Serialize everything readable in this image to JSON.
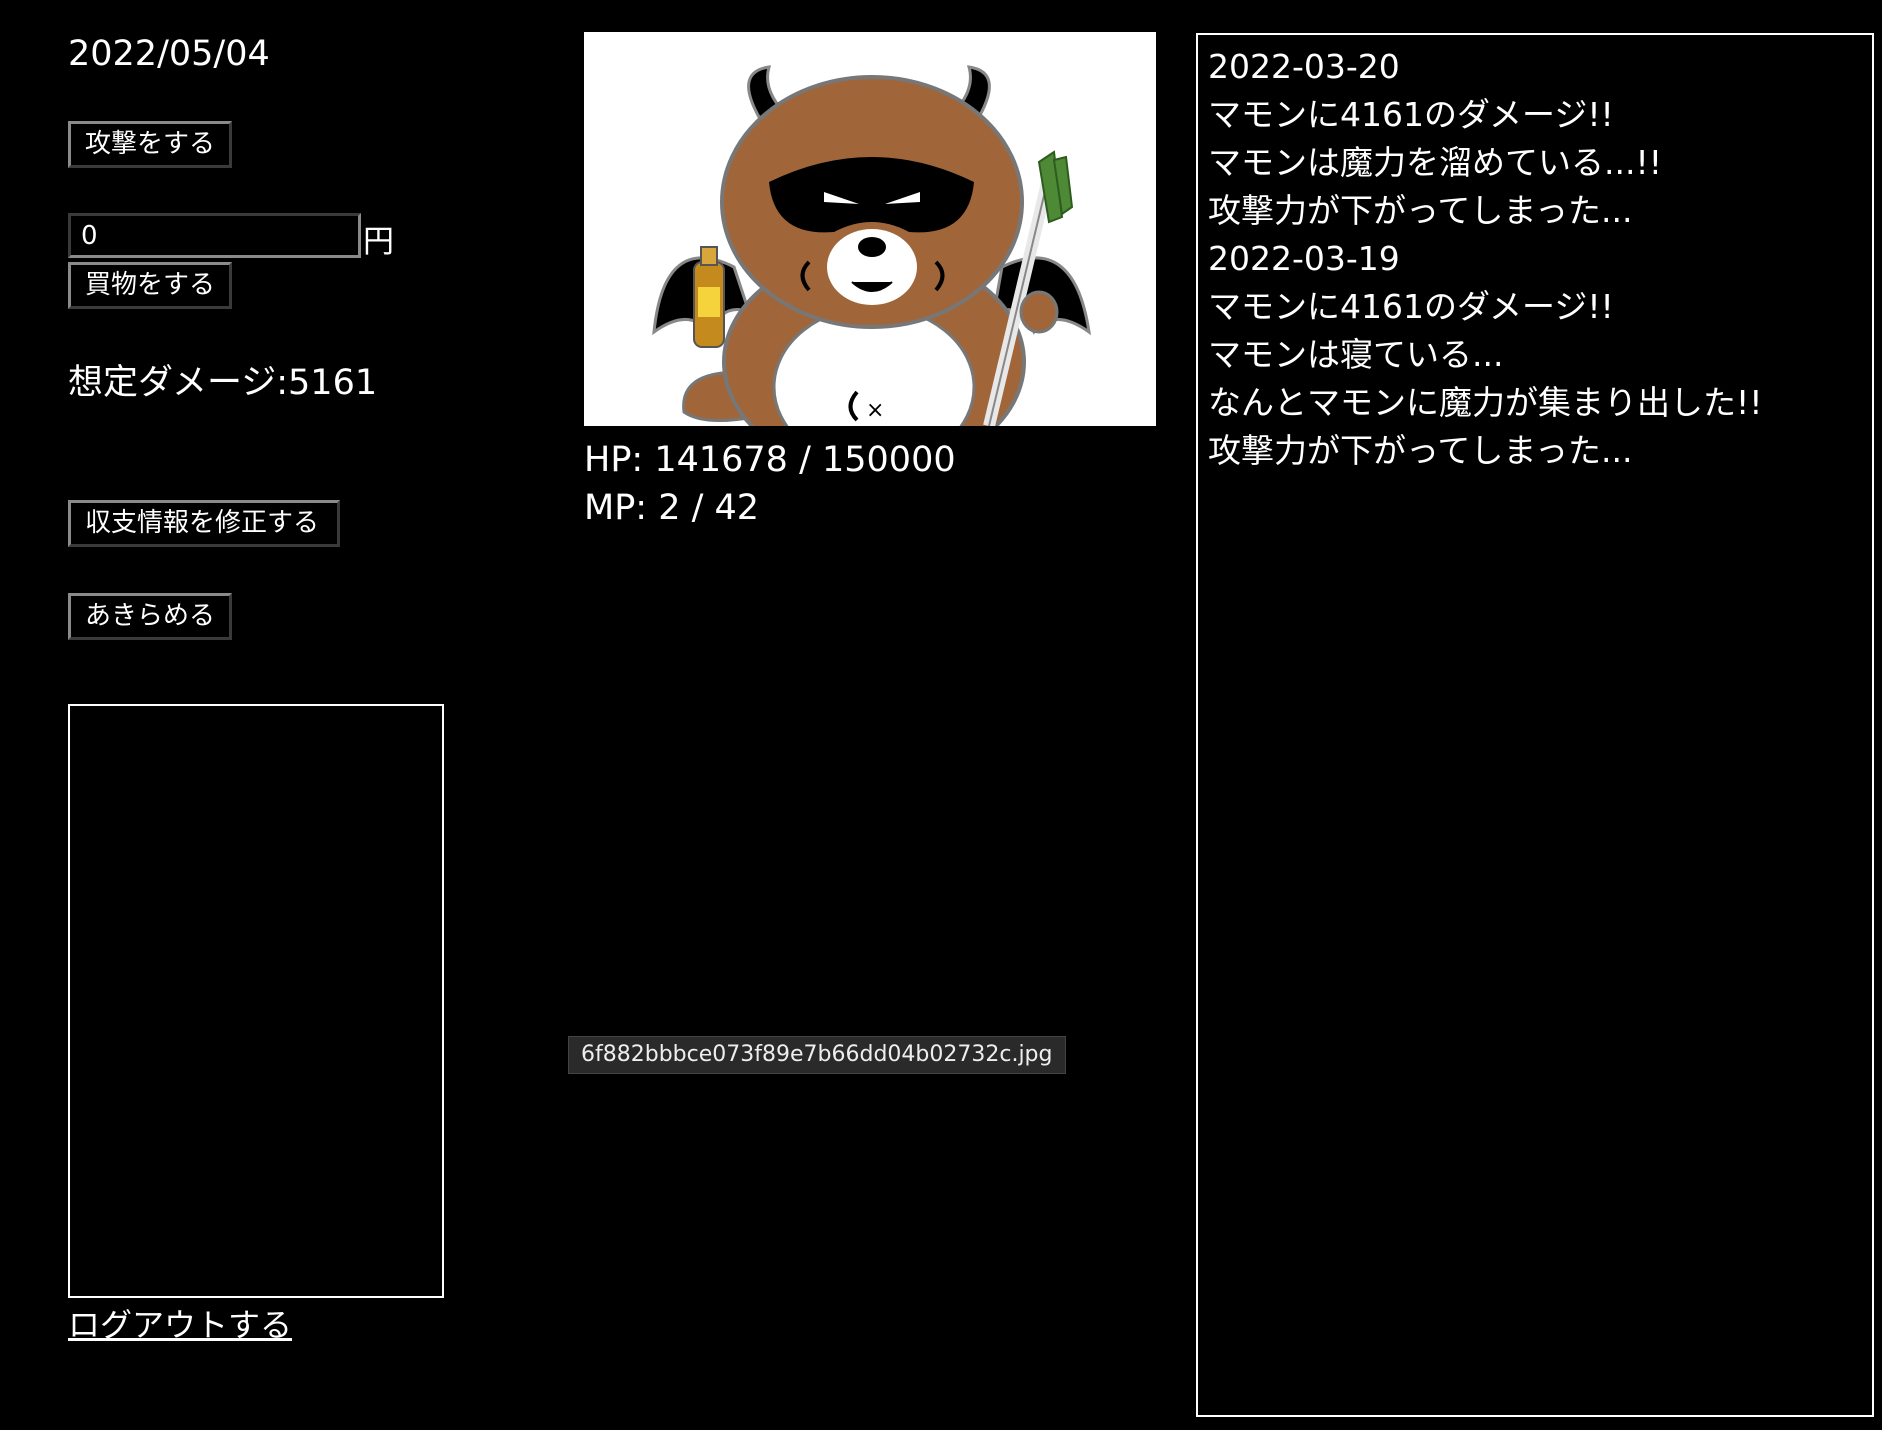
{
  "left": {
    "date": "2022/05/04",
    "attack_button": "攻撃をする",
    "amount_value": "0",
    "currency_label": "円",
    "shop_button": "買物をする",
    "damage_text": "想定ダメージ:5161",
    "edit_button": "収支情報を修正する",
    "giveup_button": "あきらめる",
    "logout_link": "ログアウトする"
  },
  "monster": {
    "hp_text": "HP: 141678 / 150000",
    "mp_text": "MP: 2 / 42",
    "image_tooltip": "6f882bbbce073f89e7b66dd04b02732c.jpg"
  },
  "log": {
    "lines": [
      "2022-03-20",
      "マモンに4161のダメージ!!",
      "マモンは魔力を溜めている...!!",
      "攻撃力が下がってしまった...",
      "2022-03-19",
      "マモンに4161のダメージ!!",
      "マモンは寝ている...",
      "なんとマモンに魔力が集まり出した!!",
      "攻撃力が下がってしまった..."
    ]
  },
  "colors": {
    "background": "#000000",
    "text": "#ffffff",
    "monster_fur": "#a0663a",
    "mask": "#000000",
    "leek_green": "#4e8a35"
  }
}
